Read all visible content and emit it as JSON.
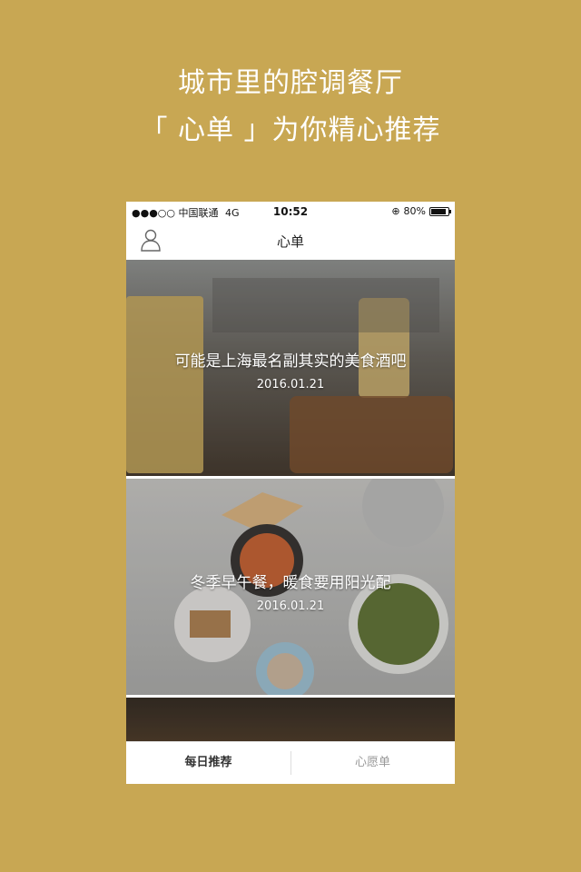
{
  "promo": {
    "line1": "城市里的腔调餐厅",
    "line2": "「 心单 」为你精心推荐"
  },
  "status_bar": {
    "signal": "●●●○○",
    "carrier": "中国联通",
    "network": "4G",
    "time": "10:52",
    "battery": "80%"
  },
  "nav": {
    "title": "心单",
    "user_icon": "user-icon"
  },
  "feed": [
    {
      "title": "可能是上海最名副其实的美食酒吧",
      "date": "2016.01.21"
    },
    {
      "title": "冬季早午餐，暖食要用阳光配",
      "date": "2016.01.21"
    }
  ],
  "tabs": {
    "daily": "每日推荐",
    "wishlist": "心愿单"
  },
  "colors": {
    "background": "#c8a753",
    "tab_active": "#333333",
    "tab_inactive": "#999999"
  }
}
